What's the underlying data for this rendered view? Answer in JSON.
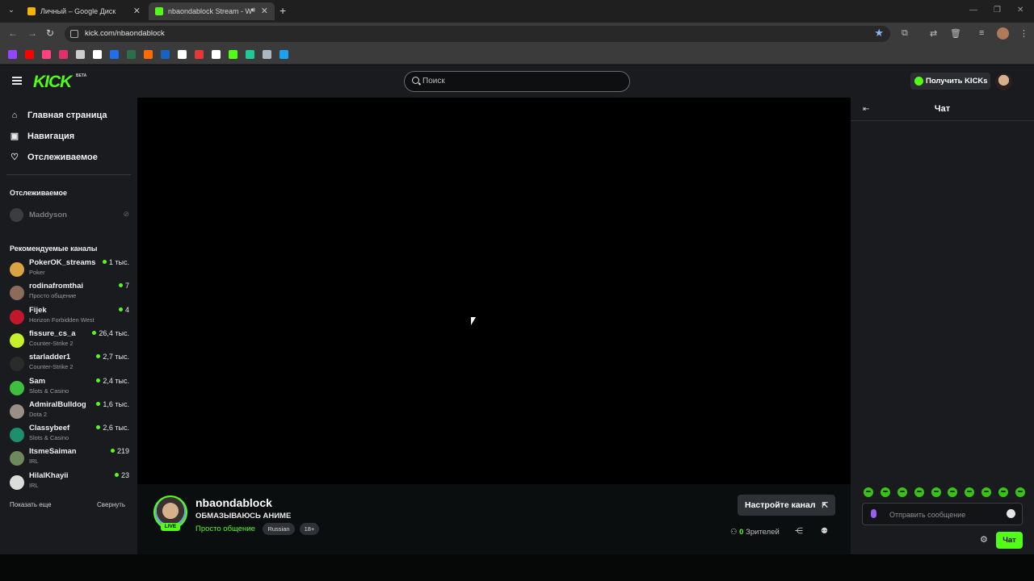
{
  "browser": {
    "tabs": [
      {
        "title": "Личный – Google Диск",
        "favicon_color": "#f4b400",
        "active": false
      },
      {
        "title": "nbaondablock Stream - Wa",
        "favicon_color": "#53fc18",
        "active": true
      }
    ],
    "url": "kick.com/nbaondablock",
    "bookmark_colors": [
      "#9146ff",
      "#ff0000",
      "#ff4081",
      "#e1306c",
      "#cccccc",
      "#ffffff",
      "#1f6feb",
      "#2c6e49",
      "#ff6b00",
      "#1565c0",
      "#ffffff",
      "#e53935",
      "#ffffff",
      "#53fc18",
      "#20c997",
      "#aab8c2",
      "#1da1f2"
    ]
  },
  "header": {
    "logo": "KICK",
    "beta": "BETA",
    "search_placeholder": "Поиск",
    "get_kicks": "Получить KICKs"
  },
  "sidebar": {
    "nav": [
      {
        "label": "Главная страница",
        "icon": "home-icon",
        "glyph": "⌂"
      },
      {
        "label": "Навигация",
        "icon": "browse-icon",
        "glyph": "▣"
      },
      {
        "label": "Отслеживаемое",
        "icon": "heart-icon",
        "glyph": "♡"
      }
    ],
    "followed_title": "Отслеживаемое",
    "followed": [
      {
        "name": "Maddyson"
      }
    ],
    "recommended_title": "Рекомендуемые каналы",
    "recommended": [
      {
        "name": "PokerOK_streams",
        "category": "Poker",
        "viewers": "1 тыс.",
        "color": "#d9a441"
      },
      {
        "name": "rodinafromthai",
        "category": "Просто общение",
        "viewers": "7",
        "color": "#8b6b5a"
      },
      {
        "name": "Fijek",
        "category": "Horizon Forbidden West",
        "viewers": "4",
        "color": "#c0182a"
      },
      {
        "name": "fissure_cs_a",
        "category": "Counter-Strike 2",
        "viewers": "26,4 тыс.",
        "color": "#c6f02a"
      },
      {
        "name": "starladder1",
        "category": "Counter-Strike 2",
        "viewers": "2,7 тыс.",
        "color": "#2b2b2b"
      },
      {
        "name": "Sam",
        "category": "Slots & Casino",
        "viewers": "2,4 тыс.",
        "color": "#3fbf3f"
      },
      {
        "name": "AdmiralBulldog",
        "category": "Dota 2",
        "viewers": "1,6 тыс.",
        "color": "#9a8f84"
      },
      {
        "name": "Classybeef",
        "category": "Slots & Casino",
        "viewers": "2,6 тыс.",
        "color": "#1d8f6a"
      },
      {
        "name": "ItsmeSaiman",
        "category": "IRL",
        "viewers": "219",
        "color": "#6f8a5a"
      },
      {
        "name": "HilalKhayii",
        "category": "IRL",
        "viewers": "23",
        "color": "#dcdcdc"
      }
    ],
    "show_more": "Показать еще",
    "collapse": "Свернуть"
  },
  "channel": {
    "name": "nbaondablock",
    "title": "ОБМАЗЫВАЮСЬ АНИМЕ",
    "category": "Просто общение",
    "tags": [
      "Russian",
      "18+"
    ],
    "live": "LIVE",
    "setup_button": "Настройте канал",
    "viewers_count": "0",
    "viewers_label": "Зрителей"
  },
  "chat": {
    "title": "Чат",
    "placeholder": "Отправить сообщение",
    "send": "Чат",
    "emote_count": 10
  }
}
